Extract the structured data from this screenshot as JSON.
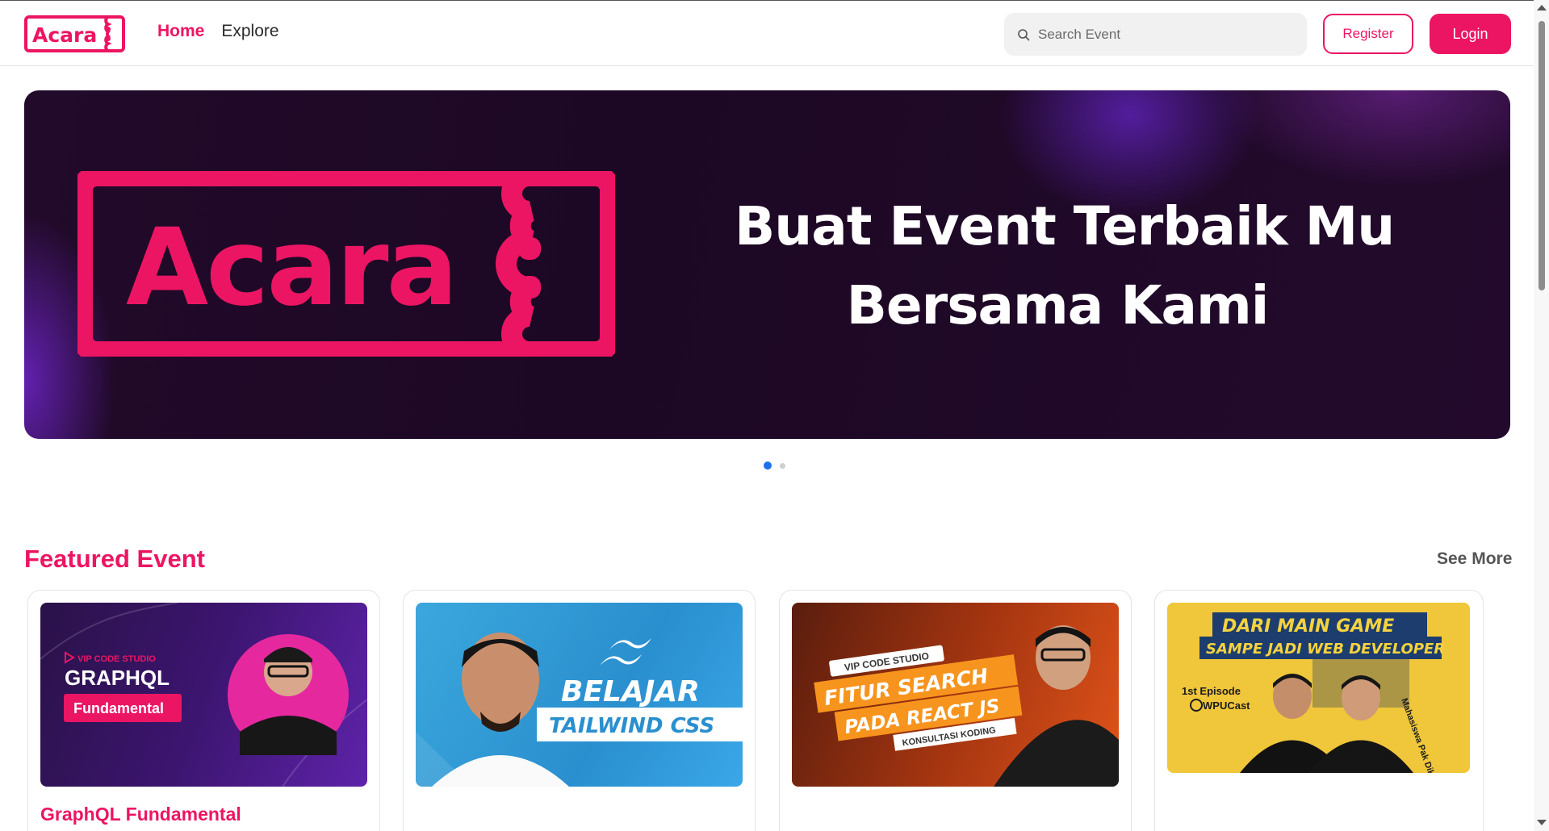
{
  "nav": {
    "logo_text": "Acara",
    "links": [
      {
        "label": "Home",
        "active": true
      },
      {
        "label": "Explore",
        "active": false
      }
    ],
    "search_placeholder": "Search Event",
    "register_label": "Register",
    "login_label": "Login"
  },
  "hero": {
    "logo_text": "Acara",
    "title_line1": "Buat Event Terbaik Mu",
    "title_line2": "Bersama Kami",
    "slides_count": 2,
    "active_slide": 1
  },
  "featured": {
    "title": "Featured Event",
    "see_more": "See More",
    "cards": [
      {
        "title": "GraphQL Fundamental",
        "thumb_brand": "VIP CODE STUDIO",
        "thumb_line1": "GRAPHQL",
        "thumb_line2": "Fundamental"
      },
      {
        "title": "",
        "thumb_line1": "BELAJAR",
        "thumb_line2": "TAILWIND CSS"
      },
      {
        "title": "",
        "thumb_brand": "VIP CODE STUDIO",
        "thumb_line1": "FITUR SEARCH",
        "thumb_line2": "PADA REACT JS",
        "thumb_line3": "KONSULTASI KODING"
      },
      {
        "title": "",
        "thumb_line1": "DARI MAIN GAME",
        "thumb_line2": "SAMPE JADI WEB DEVELOPER",
        "thumb_line3": "1st Episode",
        "thumb_line4": "WPUCast",
        "thumb_line5": "Mahasiswa Pak Dikha"
      }
    ]
  },
  "colors": {
    "brand": "#ec1563",
    "dot_active": "#1a73e8"
  }
}
